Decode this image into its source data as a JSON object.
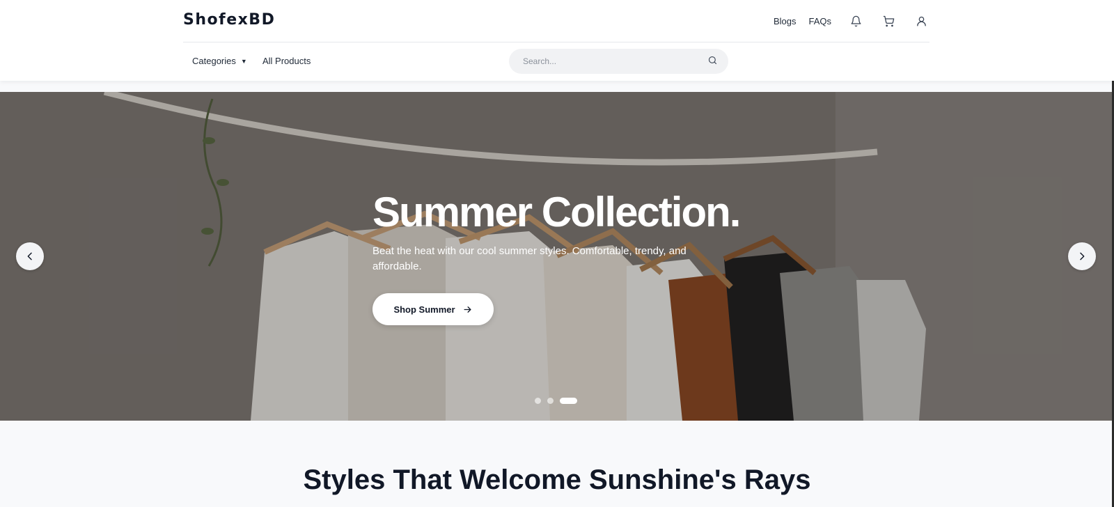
{
  "header": {
    "logo": "ShofexBD",
    "links": [
      "Blogs",
      "FAQs"
    ],
    "icons": [
      "bell-icon",
      "cart-icon",
      "user-icon"
    ],
    "categories_label": "Categories",
    "all_products_label": "All Products",
    "search": {
      "placeholder": "Search..."
    }
  },
  "hero": {
    "title": "Summer Collection.",
    "subtitle": "Beat the heat with our cool summer styles. Comfortable, trendy, and affordable.",
    "cta_label": "Shop Summer",
    "slide_count": 3,
    "active_slide": 3
  },
  "section": {
    "title": "Styles That Welcome Sunshine's Rays"
  },
  "colors": {
    "text": "#111827",
    "header_bg": "#ffffff",
    "page_bg": "#f8f9fb",
    "search_bg": "#f1f2f4"
  }
}
